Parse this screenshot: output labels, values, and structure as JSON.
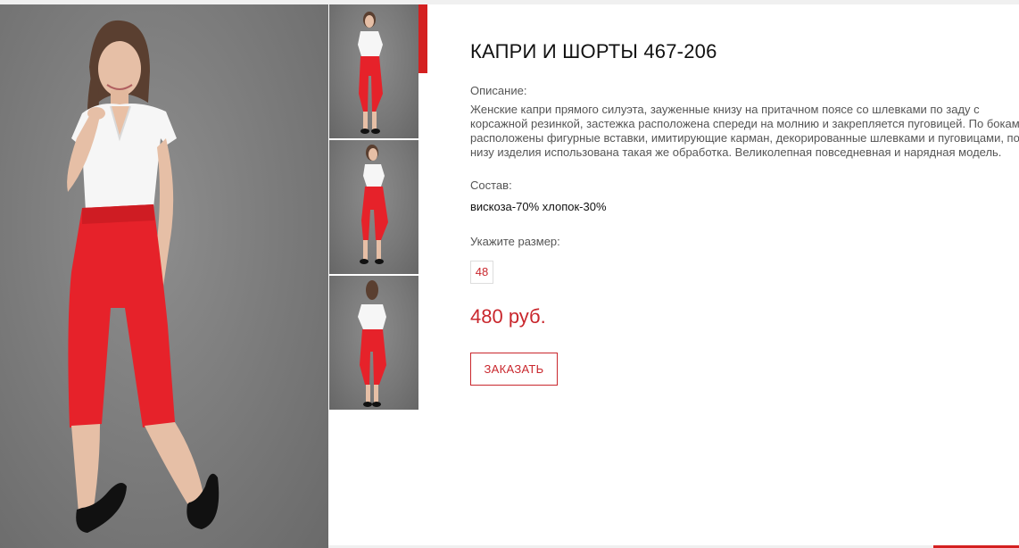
{
  "product": {
    "title": "КАПРИ И ШОРТЫ 467-206",
    "description_label": "Описание:",
    "description_lines": [
      "Женские капри прямого силуэта, зауженные книзу на притачном поясе со шлевками по заду с",
      "корсажной резинкой, застежка расположена спереди на молнию и закрепляется пуговицей. По бокам",
      "расположены фигурные вставки, имитирующие карман, декорированные шлевками и пуговицами, по",
      "низу изделия использована такая же обработка. Великолепная повседневная и нарядная модель."
    ],
    "composition_label": "Состав:",
    "composition": "вискоза-70% хлопок-30%",
    "size_label": "Укажите размер:",
    "sizes": [
      "48"
    ],
    "price": "480 руб.",
    "order_button": "ЗАКАЗАТЬ"
  },
  "gallery": {
    "main_image": "model-front-photo",
    "thumbnails": [
      "model-front-thumb",
      "model-side-thumb",
      "model-back-thumb"
    ]
  },
  "colors": {
    "accent": "#c9272d",
    "pants": "#e6222a",
    "backdrop": "#7d7d7d"
  }
}
